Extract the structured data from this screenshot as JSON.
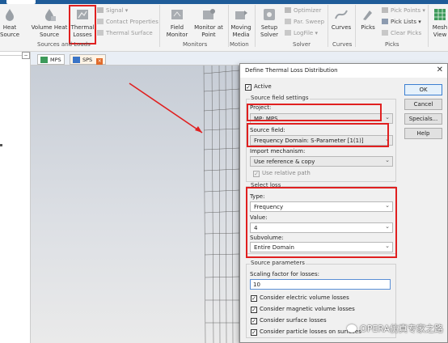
{
  "ribbon": {
    "buttons": [
      {
        "label": "Heat\nSource",
        "id": "heat-source"
      },
      {
        "label": "Volume Heat\nSource",
        "id": "volume-heat-source"
      },
      {
        "label": "Thermal\nLosses",
        "id": "thermal-losses"
      },
      {
        "label": "Field\nMonitor",
        "id": "field-monitor"
      },
      {
        "label": "Monitor at\nPoint",
        "id": "monitor-at-point"
      },
      {
        "label": "Moving\nMedia",
        "id": "moving-media"
      },
      {
        "label": "Setup\nSolver",
        "id": "setup-solver"
      },
      {
        "label": "Curves",
        "id": "curves"
      },
      {
        "label": "Picks",
        "id": "picks"
      },
      {
        "label": "Mesh\nView",
        "id": "mesh-view"
      }
    ],
    "small_items": {
      "signal": "Signal",
      "contact_properties": "Contact Properties",
      "thermal_surface": "Thermal Surface",
      "optimizer": "Optimizer",
      "par_sweep": "Par. Sweep",
      "logfile": "LogFile",
      "pick_points": "Pick Points",
      "pick_lists": "Pick Lists",
      "clear_picks": "Clear Picks"
    },
    "groups": {
      "sources_and_loads": "Sources and Loads",
      "monitors": "Monitors",
      "motion": "Motion",
      "solver": "Solver",
      "picks": "Picks"
    }
  },
  "doc_tabs": [
    {
      "label": "MPS"
    },
    {
      "label": "SPS"
    }
  ],
  "dialog": {
    "title": "Define Thermal Loss Distribution",
    "active_label": "Active",
    "active_checked": true,
    "source_field_settings": {
      "legend": "Source field settings",
      "project_label": "Project:",
      "project_value": "MP: MPS",
      "source_field_label": "Source field:",
      "source_field_value": "Frequency Domain: S-Parameter [1(1)]",
      "import_mechanism_label": "Import mechanism:",
      "import_mechanism_value": "Use reference & copy",
      "use_relative_path_label": "Use relative path",
      "use_relative_path_checked": true
    },
    "select_loss": {
      "legend": "Select loss",
      "type_label": "Type:",
      "type_value": "Frequency",
      "value_label": "Value:",
      "value_value": "4",
      "subvolume_label": "Subvolume:",
      "subvolume_value": "Entire Domain"
    },
    "source_parameters": {
      "legend": "Source parameters",
      "scaling_label": "Scaling factor for losses:",
      "scaling_value": "10",
      "checks": [
        {
          "label": "Consider electric volume losses",
          "checked": true
        },
        {
          "label": "Consider magnetic volume losses",
          "checked": true
        },
        {
          "label": "Consider surface losses",
          "checked": true
        },
        {
          "label": "Consider particle losses on surfaces",
          "checked": true
        }
      ]
    },
    "buttons": {
      "ok": "OK",
      "cancel": "Cancel",
      "specials": "Specials...",
      "help": "Help"
    }
  },
  "watermark": "OPERA仿真专家之路",
  "colors": {
    "highlight": "#e02020",
    "ribbon_top": "#1f5c99",
    "focus_border": "#5a8fd6"
  }
}
